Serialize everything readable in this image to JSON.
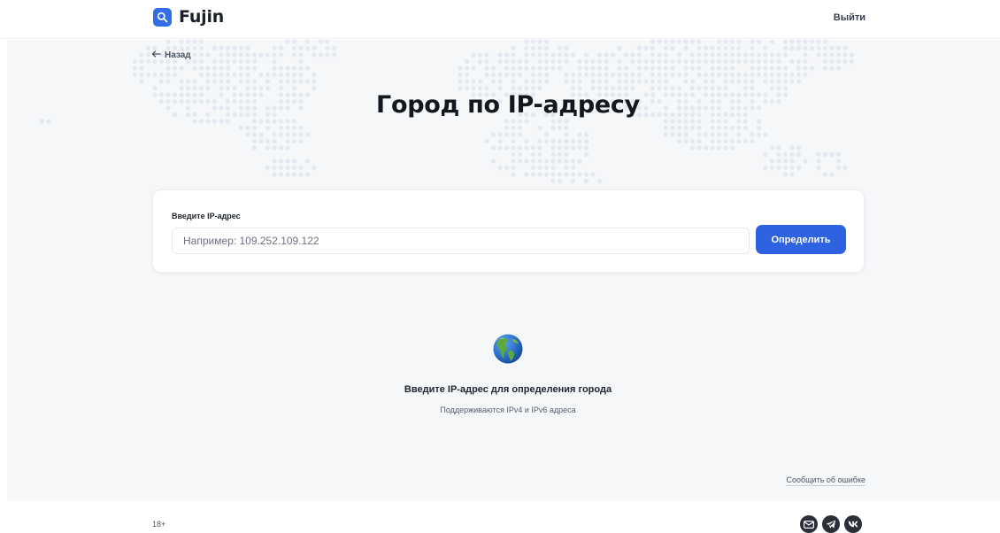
{
  "header": {
    "logo_text": "Fujin",
    "logout_label": "Выйти"
  },
  "nav": {
    "back_label": "Назад"
  },
  "page": {
    "title": "Город по IP-адресу"
  },
  "form": {
    "label": "Введите IP-адрес",
    "placeholder": "Например: 109.252.109.122",
    "value": "",
    "submit_label": "Определить"
  },
  "empty_state": {
    "icon": "globe-americas-icon",
    "title": "Введите IP-адрес для определения города",
    "subtitle": "Поддерживаются IPv4 и IPv6 адреса"
  },
  "report_link": "Сообщить об ошибке",
  "footer": {
    "age_rating": "18+",
    "socials": [
      "mail-icon",
      "telegram-icon",
      "vk-icon"
    ]
  },
  "colors": {
    "accent": "#2f62e0",
    "background": "#f6f7f9",
    "map_dots": "#e3e8f1"
  }
}
